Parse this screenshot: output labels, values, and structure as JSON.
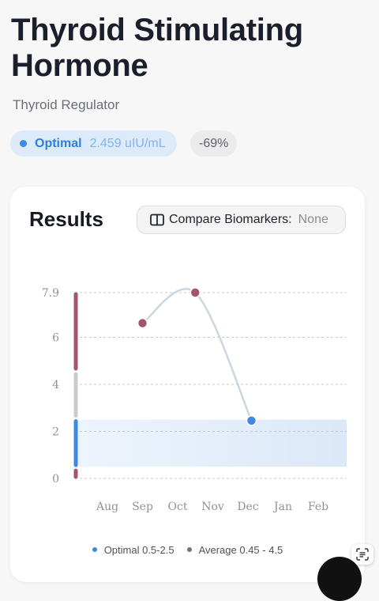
{
  "page": {
    "title": "Thyroid Stimulating Hormone",
    "subtitle": "Thyroid Regulator"
  },
  "status": {
    "label": "Optimal",
    "value": "2.459 uIU/mL",
    "delta": "-69%",
    "color": "#3d8ae0"
  },
  "results": {
    "title": "Results",
    "compare_label": "Compare Biomarkers:",
    "compare_value": "None",
    "compare_icon": "book-open-icon"
  },
  "chart_data": {
    "type": "line",
    "y_ticks": [
      "0",
      "2",
      "4",
      "6",
      "7.9"
    ],
    "y_tick_values": [
      0,
      2,
      4,
      6,
      7.9
    ],
    "ylim": [
      0,
      7.9
    ],
    "x_ticks": [
      "Aug",
      "Sep",
      "Oct",
      "Nov",
      "Dec",
      "Jan",
      "Feb"
    ],
    "grid": true,
    "series": [
      {
        "x": [
          1.0,
          2.5,
          4.1
        ],
        "values": [
          6.6,
          7.9,
          2.459
        ],
        "point_colors": [
          "#a2566d",
          "#a2566d",
          "#3d8ae0"
        ]
      }
    ],
    "optimal_band": [
      0.5,
      2.5
    ],
    "range_bar": [
      {
        "from": 0,
        "to": 0.4,
        "color": "#a2566d"
      },
      {
        "from": 0.5,
        "to": 2.5,
        "color": "#3d8ae0"
      },
      {
        "from": 2.6,
        "to": 4.5,
        "color": "#c9cccf"
      },
      {
        "from": 4.6,
        "to": 7.9,
        "color": "#a2566d"
      }
    ],
    "legend": [
      {
        "label": "Optimal 0.5-2.5",
        "color": "#3d8ae0"
      },
      {
        "label": "Average 0.45 - 4.5",
        "color": "#707379"
      }
    ]
  },
  "icons": {
    "scan": "scan-text-icon"
  }
}
